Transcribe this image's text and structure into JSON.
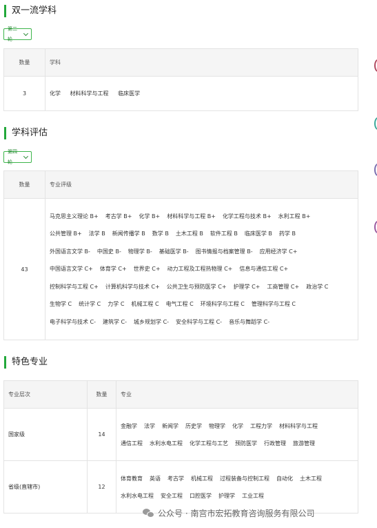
{
  "syl": {
    "title": "双一流学科",
    "round": "第二轮",
    "headers": [
      "数量",
      "学科"
    ],
    "count": "3",
    "subjects": [
      "化学",
      "材料科学与工程",
      "临床医学"
    ]
  },
  "eval": {
    "title": "学科评估",
    "round": "第四轮",
    "headers": [
      "数量",
      "专业评级"
    ],
    "count": "43",
    "lines": [
      [
        "马克思主义理论 B+",
        "考古学 B+",
        "化学 B+",
        "材料科学与工程 B+",
        "化学工程与技术 B+",
        "水利工程 B+"
      ],
      [
        "公共管理 B+",
        "法学 B",
        "新闻传播学 B",
        "数学 B",
        "土木工程 B",
        "软件工程 B",
        "临床医学 B",
        "药学 B"
      ],
      [
        "外国语言文学 B-",
        "中国史 B-",
        "物理学 B-",
        "基础医学 B-",
        "图书情报与档案管理 B-",
        "应用经济学 C+"
      ],
      [
        "中国语言文学 C+",
        "体育学 C+",
        "世界史 C+",
        "动力工程及工程热物理 C+",
        "信息与通信工程 C+"
      ],
      [
        "控制科学与工程 C+",
        "计算机科学与技术 C+",
        "公共卫生与预防医学 C+",
        "护理学 C+",
        "工商管理 C+",
        "政治学 C"
      ],
      [
        "生物学 C",
        "统计学 C",
        "力学 C",
        "机械工程 C",
        "电气工程 C",
        "环境科学与工程 C",
        "管理科学与工程 C"
      ],
      [
        "电子科学与技术 C-",
        "建筑学 C-",
        "城乡规划学 C-",
        "安全科学与工程 C-",
        "音乐与舞蹈学 C-"
      ]
    ]
  },
  "tese": {
    "title": "特色专业",
    "headers": [
      "专业层次",
      "数量",
      "专业"
    ],
    "rows": [
      {
        "level": "国家级",
        "count": "14",
        "lines": [
          [
            "金融学",
            "法学",
            "新闻学",
            "历史学",
            "物理学",
            "化学",
            "工程力学",
            "材料科学与工程"
          ],
          [
            "通信工程",
            "水利水电工程",
            "化学工程与工艺",
            "预防医学",
            "行政管理",
            "旅游管理"
          ]
        ]
      },
      {
        "level": "省级(直辖市)",
        "count": "12",
        "lines": [
          [
            "体育教育",
            "英语",
            "考古学",
            "机械工程",
            "过程装备与控制工程",
            "自动化",
            "土木工程"
          ],
          [
            "水利水电工程",
            "安全工程",
            "口腔医学",
            "护理学",
            "工业工程"
          ]
        ]
      }
    ]
  },
  "watermark": {
    "text": "公众号 · 南宫市宏拓教育咨询服务有限公司",
    "icon": "wechat-icon"
  },
  "accent_color": "#22a83a"
}
